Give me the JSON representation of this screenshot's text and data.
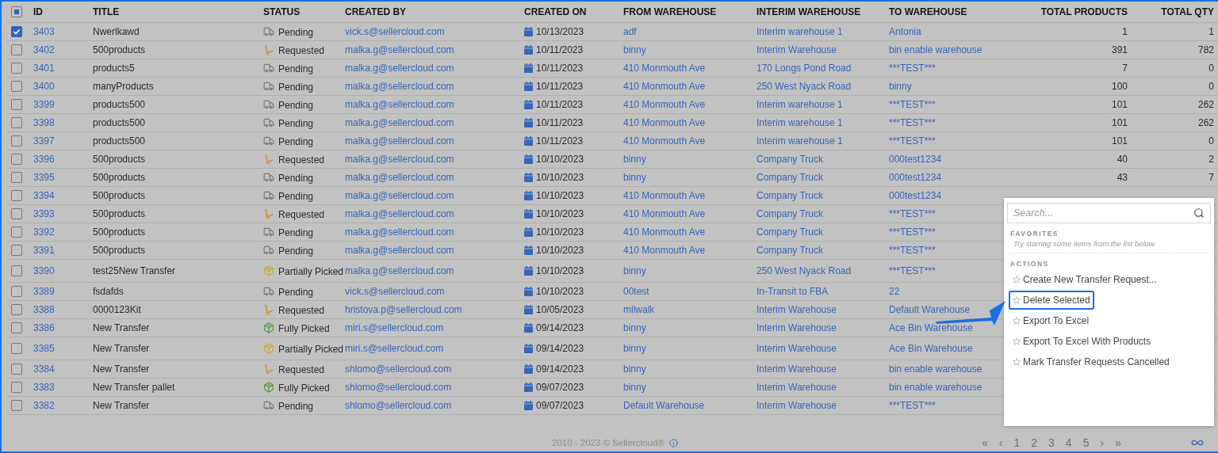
{
  "table": {
    "header_checkbox": {
      "indeterminate": true
    },
    "columns": [
      "ID",
      "TITLE",
      "STATUS",
      "CREATED BY",
      "CREATED ON",
      "FROM WAREHOUSE",
      "INTERIM WAREHOUSE",
      "TO WAREHOUSE",
      "TOTAL PRODUCTS",
      "TOTAL QTY"
    ],
    "rows": [
      {
        "checked": true,
        "id": "3403",
        "title": "Nwerlkawd",
        "status": {
          "kind": "pending",
          "label": "Pending"
        },
        "created_by": "vick.s@sellercloud.com",
        "created_on": "10/13/2023",
        "from": "adf",
        "interim": "Interim warehouse 1",
        "to": "Antonia",
        "total_products": "1",
        "total_qty": "1"
      },
      {
        "checked": false,
        "id": "3402",
        "title": "500products",
        "status": {
          "kind": "requested",
          "label": "Requested"
        },
        "created_by": "malka.g@sellercloud.com",
        "created_on": "10/11/2023",
        "from": "binny",
        "interim": "Interim Warehouse",
        "to": "bin enable warehouse",
        "total_products": "391",
        "total_qty": "782"
      },
      {
        "checked": false,
        "id": "3401",
        "title": "products5",
        "status": {
          "kind": "pending",
          "label": "Pending"
        },
        "created_by": "malka.g@sellercloud.com",
        "created_on": "10/11/2023",
        "from": "410 Monmouth Ave",
        "interim": "170 Longs Pond Road",
        "to": "***TEST***",
        "total_products": "7",
        "total_qty": "0"
      },
      {
        "checked": false,
        "id": "3400",
        "title": "manyProducts",
        "status": {
          "kind": "pending",
          "label": "Pending"
        },
        "created_by": "malka.g@sellercloud.com",
        "created_on": "10/11/2023",
        "from": "410 Monmouth Ave",
        "interim": "250 West Nyack Road",
        "to": "binny",
        "total_products": "100",
        "total_qty": "0"
      },
      {
        "checked": false,
        "id": "3399",
        "title": "products500",
        "status": {
          "kind": "pending",
          "label": "Pending"
        },
        "created_by": "malka.g@sellercloud.com",
        "created_on": "10/11/2023",
        "from": "410 Monmouth Ave",
        "interim": "Interim warehouse 1",
        "to": "***TEST***",
        "total_products": "101",
        "total_qty": "262"
      },
      {
        "checked": false,
        "id": "3398",
        "title": "products500",
        "status": {
          "kind": "pending",
          "label": "Pending"
        },
        "created_by": "malka.g@sellercloud.com",
        "created_on": "10/11/2023",
        "from": "410 Monmouth Ave",
        "interim": "Interim warehouse 1",
        "to": "***TEST***",
        "total_products": "101",
        "total_qty": "262"
      },
      {
        "checked": false,
        "id": "3397",
        "title": "products500",
        "status": {
          "kind": "pending",
          "label": "Pending"
        },
        "created_by": "malka.g@sellercloud.com",
        "created_on": "10/11/2023",
        "from": "410 Monmouth Ave",
        "interim": "Interim warehouse 1",
        "to": "***TEST***",
        "total_products": "101",
        "total_qty": "0"
      },
      {
        "checked": false,
        "id": "3396",
        "title": "500products",
        "status": {
          "kind": "requested",
          "label": "Requested"
        },
        "created_by": "malka.g@sellercloud.com",
        "created_on": "10/10/2023",
        "from": "binny",
        "interim": "Company Truck",
        "to": "000test1234",
        "total_products": "40",
        "total_qty": "2"
      },
      {
        "checked": false,
        "id": "3395",
        "title": "500products",
        "status": {
          "kind": "pending",
          "label": "Pending"
        },
        "created_by": "malka.g@sellercloud.com",
        "created_on": "10/10/2023",
        "from": "binny",
        "interim": "Company Truck",
        "to": "000test1234",
        "total_products": "43",
        "total_qty": "7"
      },
      {
        "checked": false,
        "id": "3394",
        "title": "500products",
        "status": {
          "kind": "pending",
          "label": "Pending"
        },
        "created_by": "malka.g@sellercloud.com",
        "created_on": "10/10/2023",
        "from": "410 Monmouth Ave",
        "interim": "Company Truck",
        "to": "000test1234"
      },
      {
        "checked": false,
        "id": "3393",
        "title": "500products",
        "status": {
          "kind": "requested",
          "label": "Requested"
        },
        "created_by": "malka.g@sellercloud.com",
        "created_on": "10/10/2023",
        "from": "410 Monmouth Ave",
        "interim": "Company Truck",
        "to": "***TEST***"
      },
      {
        "checked": false,
        "id": "3392",
        "title": "500products",
        "status": {
          "kind": "pending",
          "label": "Pending"
        },
        "created_by": "malka.g@sellercloud.com",
        "created_on": "10/10/2023",
        "from": "410 Monmouth Ave",
        "interim": "Company Truck",
        "to": "***TEST***"
      },
      {
        "checked": false,
        "id": "3391",
        "title": "500products",
        "status": {
          "kind": "pending",
          "label": "Pending"
        },
        "created_by": "malka.g@sellercloud.com",
        "created_on": "10/10/2023",
        "from": "410 Monmouth Ave",
        "interim": "Company Truck",
        "to": "***TEST***"
      },
      {
        "checked": false,
        "id": "3390",
        "title": "test25New Transfer",
        "status": {
          "kind": "partial",
          "label": "Partially Picked"
        },
        "created_by": "malka.g@sellercloud.com",
        "created_on": "10/10/2023",
        "from": "binny",
        "interim": "250 West Nyack Road",
        "to": "***TEST***"
      },
      {
        "checked": false,
        "id": "3389",
        "title": "fsdafds",
        "status": {
          "kind": "pending",
          "label": "Pending"
        },
        "created_by": "vick.s@sellercloud.com",
        "created_on": "10/10/2023",
        "from": "00test",
        "interim": "In-Transit to FBA",
        "to": "22"
      },
      {
        "checked": false,
        "id": "3388",
        "title": "0000123Kit",
        "status": {
          "kind": "requested",
          "label": "Requested"
        },
        "created_by": "hristova.p@sellercloud.com",
        "created_on": "10/05/2023",
        "from": "milwalk",
        "interim": "Interim Warehouse",
        "to": "Default Warehouse"
      },
      {
        "checked": false,
        "id": "3386",
        "title": "New Transfer",
        "status": {
          "kind": "full",
          "label": "Fully Picked"
        },
        "created_by": "miri.s@sellercloud.com",
        "created_on": "09/14/2023",
        "from": "binny",
        "interim": "Interim Warehouse",
        "to": "Ace Bin Warehouse"
      },
      {
        "checked": false,
        "id": "3385",
        "title": "New Transfer",
        "status": {
          "kind": "partial",
          "label": "Partially Picked"
        },
        "created_by": "miri.s@sellercloud.com",
        "created_on": "09/14/2023",
        "from": "binny",
        "interim": "Interim Warehouse",
        "to": "Ace Bin Warehouse"
      },
      {
        "checked": false,
        "id": "3384",
        "title": "New Transfer",
        "status": {
          "kind": "requested",
          "label": "Requested"
        },
        "created_by": "shlomo@sellercloud.com",
        "created_on": "09/14/2023",
        "from": "binny",
        "interim": "Interim Warehouse",
        "to": "bin enable warehouse"
      },
      {
        "checked": false,
        "id": "3383",
        "title": "New Transfer pallet",
        "status": {
          "kind": "full",
          "label": "Fully Picked"
        },
        "created_by": "shlomo@sellercloud.com",
        "created_on": "09/07/2023",
        "from": "binny",
        "interim": "Interim Warehouse",
        "to": "bin enable warehouse"
      },
      {
        "checked": false,
        "id": "3382",
        "title": "New Transfer",
        "status": {
          "kind": "pending",
          "label": "Pending"
        },
        "created_by": "shlomo@sellercloud.com",
        "created_on": "09/07/2023",
        "from": "Default Warehouse",
        "interim": "Interim Warehouse",
        "to": "***TEST***"
      }
    ]
  },
  "actions_menu": {
    "search": {
      "placeholder": "Search..."
    },
    "favorites": {
      "heading": "FAVORITES",
      "hint": "Try starring some items from the list below."
    },
    "actions": {
      "heading": "ACTIONS",
      "items": [
        {
          "label": "Create New Transfer Request...",
          "highlighted": false
        },
        {
          "label": "Delete Selected",
          "highlighted": true
        },
        {
          "label": "Export To Excel",
          "highlighted": false
        },
        {
          "label": "Export To Excel With Products",
          "highlighted": false
        },
        {
          "label": "Mark Transfer Requests Cancelled",
          "highlighted": false
        }
      ]
    }
  },
  "footer": {
    "copyright": "2010 - 2023 © Sellercloud®",
    "pager": [
      {
        "label": "«",
        "disabled": true
      },
      {
        "label": "‹",
        "disabled": true
      },
      {
        "label": "1",
        "disabled": true
      },
      {
        "label": "2",
        "disabled": true
      },
      {
        "label": "3",
        "disabled": true
      },
      {
        "label": "4",
        "disabled": true
      },
      {
        "label": "5",
        "disabled": true
      },
      {
        "label": "›",
        "disabled": true
      },
      {
        "label": "»",
        "disabled": true
      }
    ]
  }
}
